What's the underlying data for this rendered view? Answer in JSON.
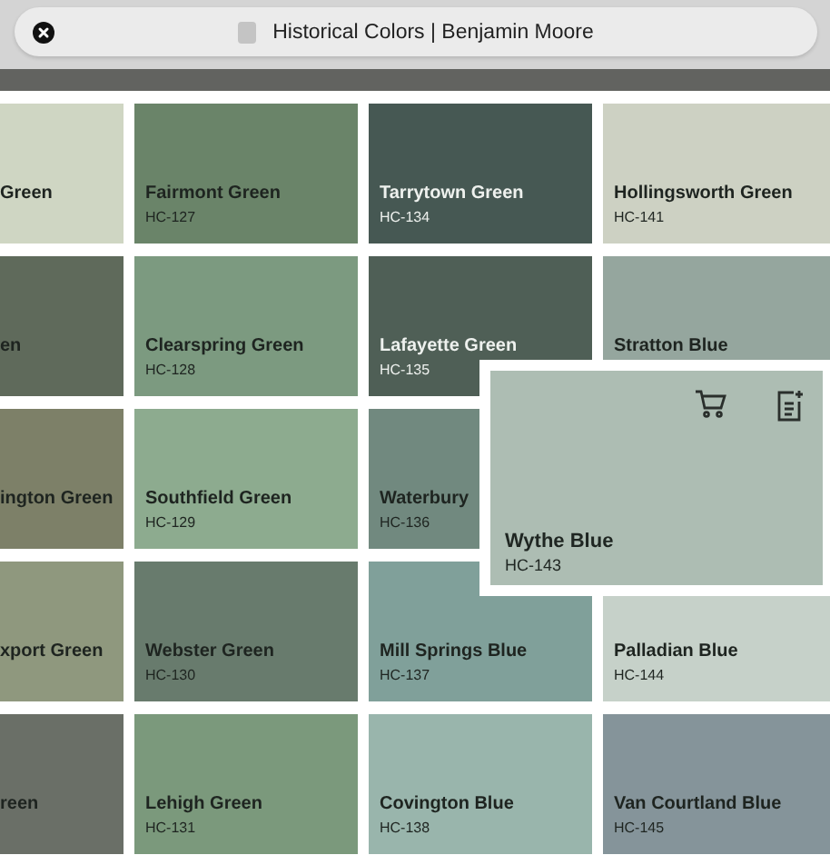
{
  "address_bar": {
    "title": "Historical Colors | Benjamin Moore"
  },
  "rows": [
    {
      "tiles": [
        {
          "name": "Green",
          "color": "#cfd6c3"
        },
        {
          "name": "Fairmont Green",
          "code": "HC-127",
          "color": "#6a8469"
        },
        {
          "name": "Tarrytown Green",
          "code": "HC-134",
          "color": "#465853"
        },
        {
          "name": "Hollingsworth Green",
          "code": "HC-141",
          "color": "#cdd1c3"
        }
      ]
    },
    {
      "tiles": [
        {
          "name": "en",
          "color": "#5f6a5b"
        },
        {
          "name": "Clearspring Green",
          "code": "HC-128",
          "color": "#7c9a80"
        },
        {
          "name": "Lafayette Green",
          "code": "HC-135",
          "color": "#4f5f56"
        },
        {
          "name": "Stratton Blue",
          "color": "#95a69e"
        }
      ]
    },
    {
      "tiles": [
        {
          "name": "ington Green",
          "color": "#7d8068"
        },
        {
          "name": "Southfield Green",
          "code": "HC-129",
          "color": "#8dab8f"
        },
        {
          "name": "Waterbury",
          "code": "HC-136",
          "color": "#71897f"
        }
      ]
    },
    {
      "tiles": [
        {
          "name": "xport Green",
          "color": "#8f987e"
        },
        {
          "name": "Webster Green",
          "code": "HC-130",
          "color": "#687b6d"
        },
        {
          "name": "Mill Springs Blue",
          "code": "HC-137",
          "color": "#80a09a"
        },
        {
          "name": "Palladian Blue",
          "code": "HC-144",
          "color": "#c6d1c9"
        }
      ]
    },
    {
      "tiles": [
        {
          "name": "reen",
          "color": "#6a6f67"
        },
        {
          "name": "Lehigh Green",
          "code": "HC-131",
          "color": "#7b997c"
        },
        {
          "name": "Covington Blue",
          "code": "HC-138",
          "color": "#99b5ac"
        },
        {
          "name": "Van Courtland Blue",
          "code": "HC-145",
          "color": "#85949a"
        }
      ]
    }
  ],
  "popup": {
    "name": "Wythe Blue",
    "code": "HC-143",
    "color": "#adbdb3"
  }
}
